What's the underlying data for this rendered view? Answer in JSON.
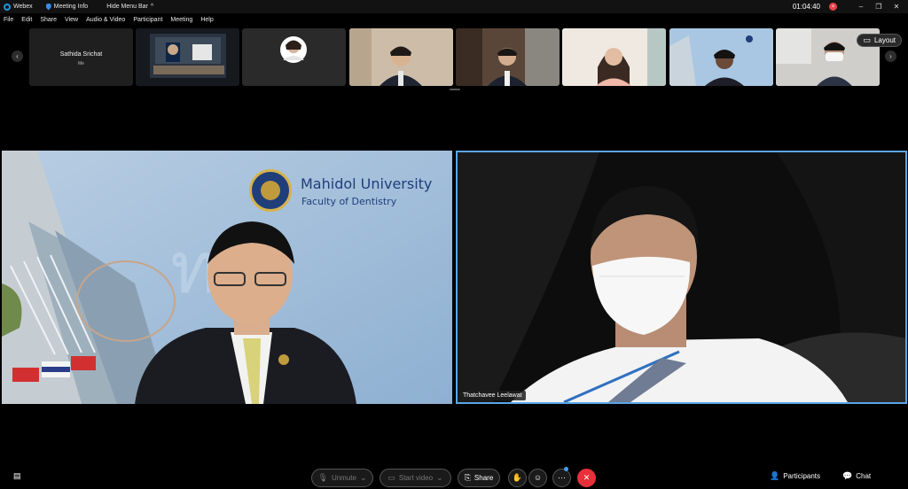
{
  "titlebar": {
    "app": "Webex",
    "meeting_info": "Meeting Info",
    "hide_menu": "Hide Menu Bar",
    "hide_menu_chevron": "^",
    "timer": "01:04:40",
    "record_icon": "recording-icon"
  },
  "menu": [
    "File",
    "Edit",
    "Share",
    "View",
    "Audio & Video",
    "Participant",
    "Meeting",
    "Help"
  ],
  "strip": {
    "first_name": "Sathida Srichat",
    "first_sub": "Me",
    "layout": "Layout"
  },
  "main": {
    "left_bg_logo_title": "Mahidol University",
    "left_bg_logo_sub": "Faculty of Dentistry",
    "left_watermark": "ทันตฯ",
    "right_name": "Thatchavee Leelawat"
  },
  "controls": {
    "unmute": "Unmute",
    "start_video": "Start video",
    "share": "Share",
    "participants": "Participants",
    "chat": "Chat"
  },
  "colors": {
    "accent": "#5aa5e6",
    "end_call": "#e8303a",
    "webex": "#1d9bd7"
  }
}
